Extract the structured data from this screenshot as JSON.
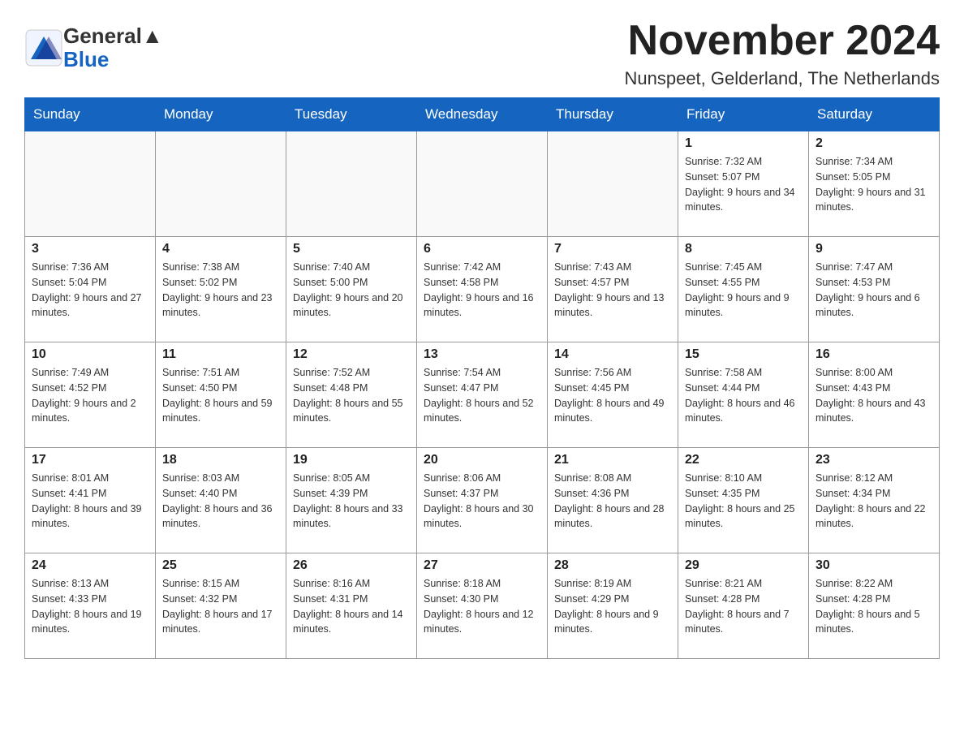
{
  "header": {
    "logo_text_general": "General",
    "logo_text_blue": "Blue",
    "month_title": "November 2024",
    "location": "Nunspeet, Gelderland, The Netherlands"
  },
  "days_of_week": [
    "Sunday",
    "Monday",
    "Tuesday",
    "Wednesday",
    "Thursday",
    "Friday",
    "Saturday"
  ],
  "weeks": [
    [
      {
        "day": "",
        "info": ""
      },
      {
        "day": "",
        "info": ""
      },
      {
        "day": "",
        "info": ""
      },
      {
        "day": "",
        "info": ""
      },
      {
        "day": "",
        "info": ""
      },
      {
        "day": "1",
        "info": "Sunrise: 7:32 AM\nSunset: 5:07 PM\nDaylight: 9 hours and 34 minutes."
      },
      {
        "day": "2",
        "info": "Sunrise: 7:34 AM\nSunset: 5:05 PM\nDaylight: 9 hours and 31 minutes."
      }
    ],
    [
      {
        "day": "3",
        "info": "Sunrise: 7:36 AM\nSunset: 5:04 PM\nDaylight: 9 hours and 27 minutes."
      },
      {
        "day": "4",
        "info": "Sunrise: 7:38 AM\nSunset: 5:02 PM\nDaylight: 9 hours and 23 minutes."
      },
      {
        "day": "5",
        "info": "Sunrise: 7:40 AM\nSunset: 5:00 PM\nDaylight: 9 hours and 20 minutes."
      },
      {
        "day": "6",
        "info": "Sunrise: 7:42 AM\nSunset: 4:58 PM\nDaylight: 9 hours and 16 minutes."
      },
      {
        "day": "7",
        "info": "Sunrise: 7:43 AM\nSunset: 4:57 PM\nDaylight: 9 hours and 13 minutes."
      },
      {
        "day": "8",
        "info": "Sunrise: 7:45 AM\nSunset: 4:55 PM\nDaylight: 9 hours and 9 minutes."
      },
      {
        "day": "9",
        "info": "Sunrise: 7:47 AM\nSunset: 4:53 PM\nDaylight: 9 hours and 6 minutes."
      }
    ],
    [
      {
        "day": "10",
        "info": "Sunrise: 7:49 AM\nSunset: 4:52 PM\nDaylight: 9 hours and 2 minutes."
      },
      {
        "day": "11",
        "info": "Sunrise: 7:51 AM\nSunset: 4:50 PM\nDaylight: 8 hours and 59 minutes."
      },
      {
        "day": "12",
        "info": "Sunrise: 7:52 AM\nSunset: 4:48 PM\nDaylight: 8 hours and 55 minutes."
      },
      {
        "day": "13",
        "info": "Sunrise: 7:54 AM\nSunset: 4:47 PM\nDaylight: 8 hours and 52 minutes."
      },
      {
        "day": "14",
        "info": "Sunrise: 7:56 AM\nSunset: 4:45 PM\nDaylight: 8 hours and 49 minutes."
      },
      {
        "day": "15",
        "info": "Sunrise: 7:58 AM\nSunset: 4:44 PM\nDaylight: 8 hours and 46 minutes."
      },
      {
        "day": "16",
        "info": "Sunrise: 8:00 AM\nSunset: 4:43 PM\nDaylight: 8 hours and 43 minutes."
      }
    ],
    [
      {
        "day": "17",
        "info": "Sunrise: 8:01 AM\nSunset: 4:41 PM\nDaylight: 8 hours and 39 minutes."
      },
      {
        "day": "18",
        "info": "Sunrise: 8:03 AM\nSunset: 4:40 PM\nDaylight: 8 hours and 36 minutes."
      },
      {
        "day": "19",
        "info": "Sunrise: 8:05 AM\nSunset: 4:39 PM\nDaylight: 8 hours and 33 minutes."
      },
      {
        "day": "20",
        "info": "Sunrise: 8:06 AM\nSunset: 4:37 PM\nDaylight: 8 hours and 30 minutes."
      },
      {
        "day": "21",
        "info": "Sunrise: 8:08 AM\nSunset: 4:36 PM\nDaylight: 8 hours and 28 minutes."
      },
      {
        "day": "22",
        "info": "Sunrise: 8:10 AM\nSunset: 4:35 PM\nDaylight: 8 hours and 25 minutes."
      },
      {
        "day": "23",
        "info": "Sunrise: 8:12 AM\nSunset: 4:34 PM\nDaylight: 8 hours and 22 minutes."
      }
    ],
    [
      {
        "day": "24",
        "info": "Sunrise: 8:13 AM\nSunset: 4:33 PM\nDaylight: 8 hours and 19 minutes."
      },
      {
        "day": "25",
        "info": "Sunrise: 8:15 AM\nSunset: 4:32 PM\nDaylight: 8 hours and 17 minutes."
      },
      {
        "day": "26",
        "info": "Sunrise: 8:16 AM\nSunset: 4:31 PM\nDaylight: 8 hours and 14 minutes."
      },
      {
        "day": "27",
        "info": "Sunrise: 8:18 AM\nSunset: 4:30 PM\nDaylight: 8 hours and 12 minutes."
      },
      {
        "day": "28",
        "info": "Sunrise: 8:19 AM\nSunset: 4:29 PM\nDaylight: 8 hours and 9 minutes."
      },
      {
        "day": "29",
        "info": "Sunrise: 8:21 AM\nSunset: 4:28 PM\nDaylight: 8 hours and 7 minutes."
      },
      {
        "day": "30",
        "info": "Sunrise: 8:22 AM\nSunset: 4:28 PM\nDaylight: 8 hours and 5 minutes."
      }
    ]
  ]
}
